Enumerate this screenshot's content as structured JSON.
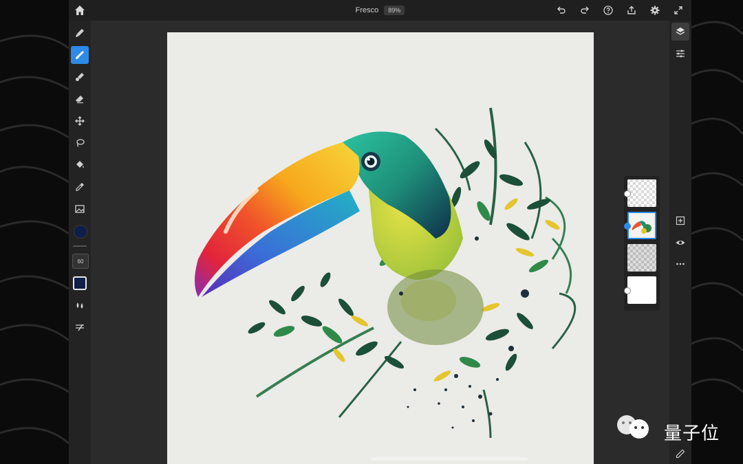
{
  "window": {
    "title": "Fresco",
    "zoom": "89%"
  },
  "toolbar": {
    "brush_size": "60",
    "current_color": "#0f1f4a",
    "accent_color": "#2d8ae8",
    "tools": [
      {
        "name": "pixel-brush-icon",
        "active": false
      },
      {
        "name": "live-brush-icon",
        "active": true
      },
      {
        "name": "vector-brush-icon",
        "active": false
      },
      {
        "name": "eraser-icon",
        "active": false
      },
      {
        "name": "move-icon",
        "active": false
      },
      {
        "name": "lasso-icon",
        "active": false
      },
      {
        "name": "fill-icon",
        "active": false
      },
      {
        "name": "eyedropper-icon",
        "active": false
      },
      {
        "name": "image-icon",
        "active": false
      }
    ]
  },
  "right_panel": {
    "tools": [
      "layers-icon",
      "layer-properties-icon",
      "add-layer-icon",
      "visibility-icon",
      "more-icon",
      "edit-icon"
    ]
  },
  "layers": [
    {
      "thumb": "transparent",
      "selected": false
    },
    {
      "thumb": "toucan",
      "selected": true
    },
    {
      "thumb": "light",
      "selected": false
    },
    {
      "thumb": "white",
      "selected": false
    }
  ],
  "watermark": {
    "text": "量子位"
  }
}
